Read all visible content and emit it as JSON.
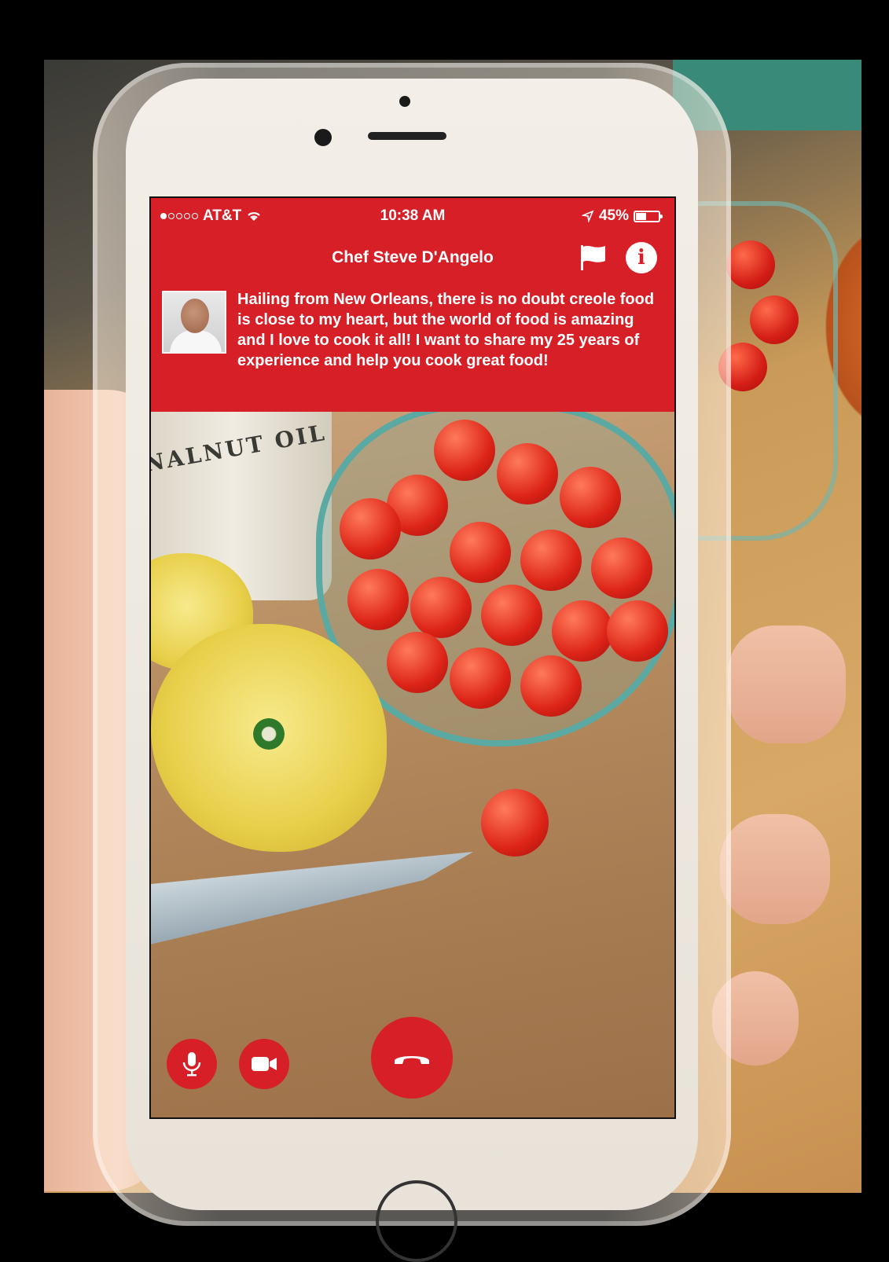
{
  "status_bar": {
    "carrier": "AT&T",
    "signal_filled": 1,
    "signal_total": 5,
    "time": "10:38 AM",
    "battery": "45%",
    "battery_level": 0.45
  },
  "header": {
    "title": "Chef Steve D'Angelo",
    "bio": "Hailing from New Orleans, there is no doubt creole food is close to my heart, but the world of food is amazing and I love to cook it all! I want to share my 25 years of experience and help you cook great food!",
    "info_icon_glyph": "i"
  },
  "camera_view": {
    "bottle_text": "NALNUT OIL"
  },
  "icons": {
    "flag": "flag-icon",
    "info": "info-icon",
    "mic": "microphone-icon",
    "video": "video-camera-icon",
    "end_call": "phone-hangup-icon",
    "wifi": "wifi-icon",
    "location": "location-arrow-icon",
    "battery": "battery-icon"
  },
  "colors": {
    "accent": "#d71f27",
    "text_on_accent": "#ffffff"
  }
}
